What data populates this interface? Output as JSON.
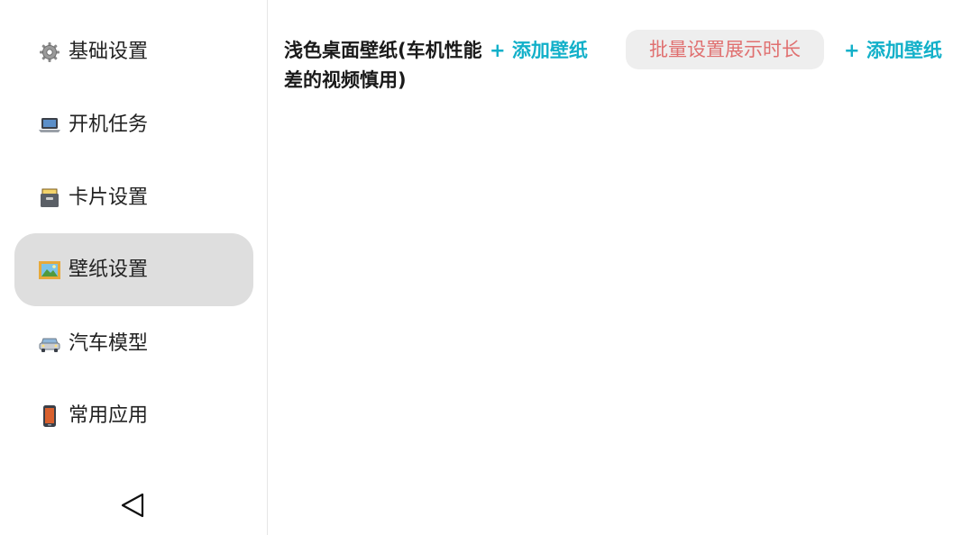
{
  "sidebar": {
    "items": [
      {
        "label": "基础设置",
        "icon": "gear-icon",
        "active": false
      },
      {
        "label": "开机任务",
        "icon": "laptop-icon",
        "active": false
      },
      {
        "label": "卡片设置",
        "icon": "card-file-box-icon",
        "active": false
      },
      {
        "label": "壁纸设置",
        "icon": "framed-picture-icon",
        "active": true
      },
      {
        "label": "汽车模型",
        "icon": "car-icon",
        "active": false
      },
      {
        "label": "常用应用",
        "icon": "mobile-phone-icon",
        "active": false
      }
    ],
    "back_icon": "back-triangle-icon"
  },
  "main": {
    "section_title": "浅色桌面壁纸(车机性能差的视频慎用)",
    "add_wallpaper_label": "+ 添加壁纸",
    "batch_button_label": "批量设置展示时长",
    "add_wallpaper_label_2": "+ 添加壁纸"
  },
  "colors": {
    "accent": "#12b0c9",
    "batch_text": "#e07070",
    "active_bg": "#dedede",
    "button_bg": "#eeeeee"
  }
}
